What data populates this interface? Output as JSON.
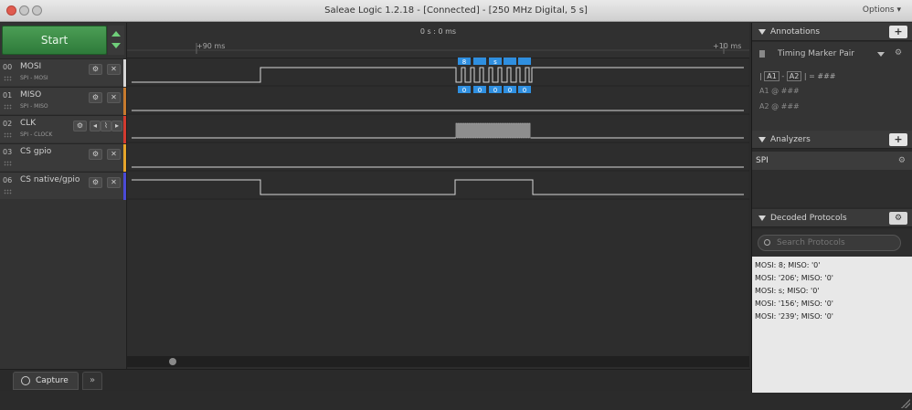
{
  "window": {
    "title": "Saleae Logic 1.2.18 - [Connected] - [250 MHz Digital, 5 s]",
    "options_label": "Options ▾"
  },
  "controls": {
    "start_label": "Start"
  },
  "channels": [
    {
      "num": "00",
      "name": "MOSI",
      "sub": "SPI - MOSI",
      "color": "#d6d6d6"
    },
    {
      "num": "01",
      "name": "MISO",
      "sub": "SPI - MISO",
      "color": "#c77a2e"
    },
    {
      "num": "02",
      "name": "CLK",
      "sub": "SPI - CLOCK",
      "color": "#d33a2f"
    },
    {
      "num": "03",
      "name": "CS gpio",
      "sub": "",
      "color": "#e6a52a"
    },
    {
      "num": "06",
      "name": "CS native/gpio",
      "sub": "",
      "color": "#4a4ad6"
    }
  ],
  "ruler": {
    "center": "0 s : 0 ms",
    "left_tick": "+90 ms",
    "right_tick": "+10 ms"
  },
  "decoded_bubbles": {
    "mosi": [
      "8",
      "",
      "s",
      "",
      ""
    ],
    "miso": [
      "0",
      "0",
      "0",
      "0",
      "0"
    ]
  },
  "tabs": {
    "capture": "Capture",
    "more": "»"
  },
  "annotations": {
    "header": "Annotations",
    "add_label": "+",
    "marker_pair": "Timing Marker Pair",
    "diff_line": [
      "|",
      "A1",
      "-",
      "A2",
      "| = ###"
    ],
    "a1_line": "A1  @  ###",
    "a2_line": "A2  @  ###"
  },
  "analyzers": {
    "header": "Analyzers",
    "add_label": "+",
    "items": [
      "SPI"
    ]
  },
  "decoded": {
    "header": "Decoded Protocols",
    "search_placeholder": "Search Protocols",
    "rows": [
      "MOSI: 8;  MISO: '0'",
      "MOSI: '206';  MISO: '0'",
      "MOSI: s;  MISO: '0'",
      "MOSI: '156';  MISO: '0'",
      "MOSI: '239';  MISO: '0'"
    ]
  },
  "colors": {
    "accent_blue": "#2f8fe0",
    "start_green": "#3a8a45"
  }
}
